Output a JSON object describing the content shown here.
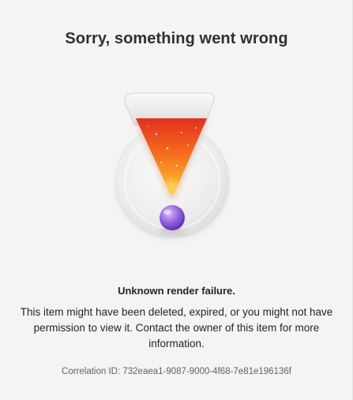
{
  "error": {
    "title": "Sorry, something went wrong",
    "illustration_icon": "exclamation-illustration",
    "heading": "Unknown render failure.",
    "body": "This item might have been deleted, expired, or you might not have permission to view it. Contact the owner of this item for more information.",
    "correlation_id": "Correlation ID: 732eaea1-9087-9000-4f68-7e81e196136f"
  },
  "colors": {
    "background": "#f4f4f4",
    "wedge_top": "#e8321f",
    "wedge_bottom": "#ffbf2a",
    "dot": "#8a5cd8"
  }
}
